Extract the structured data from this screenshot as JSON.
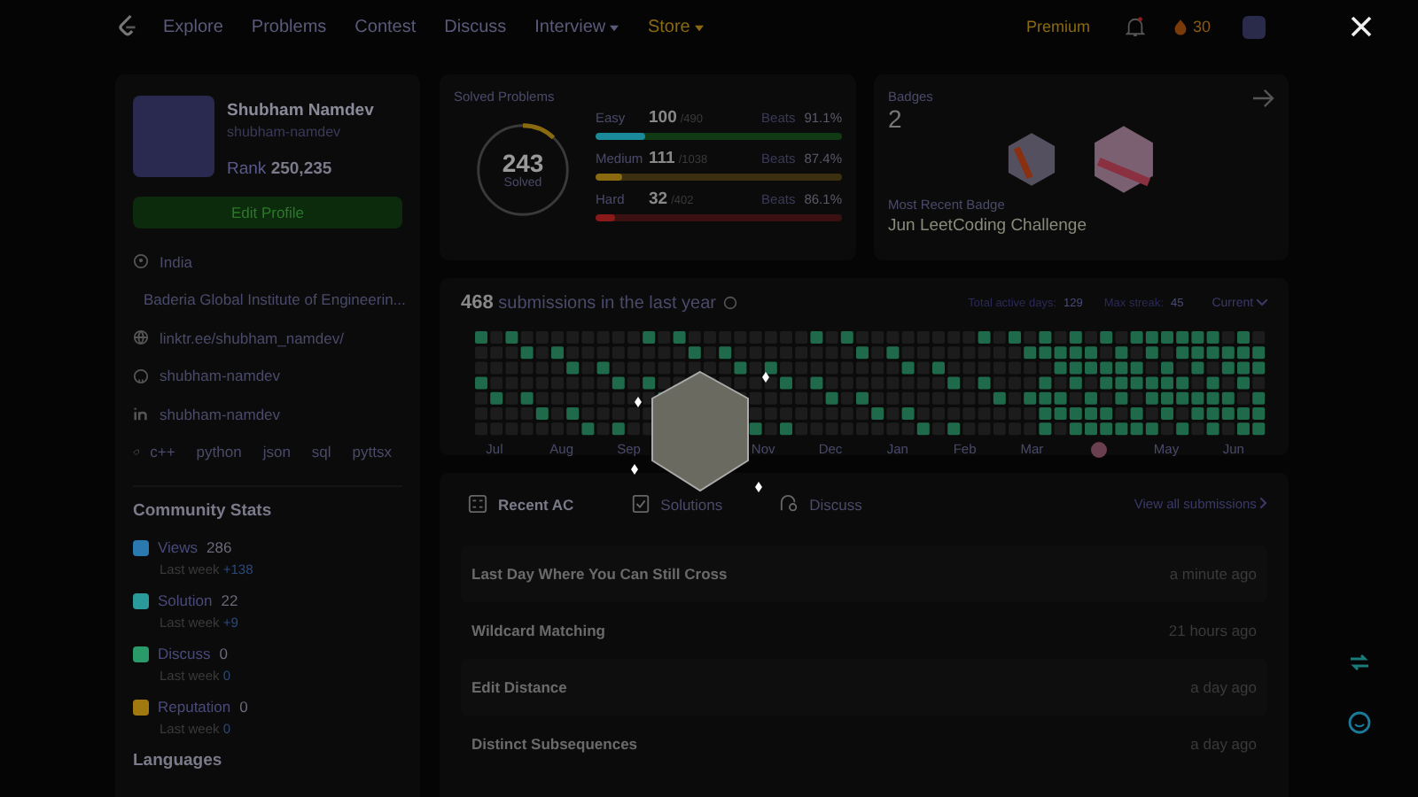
{
  "nav": {
    "items": [
      {
        "label": "Explore",
        "kind": "link"
      },
      {
        "label": "Problems",
        "kind": "link"
      },
      {
        "label": "Contest",
        "kind": "link"
      },
      {
        "label": "Discuss",
        "kind": "link"
      },
      {
        "label": "Interview",
        "kind": "menu"
      },
      {
        "label": "Store",
        "kind": "store"
      }
    ],
    "premium": "Premium",
    "coins": "30"
  },
  "profile": {
    "name": "Shubham Namdev",
    "username": "shubham-namdev",
    "rank_label": "Rank",
    "rank": "250,235",
    "edit_button": "Edit Profile",
    "details": [
      {
        "kind": "location",
        "text": "India"
      },
      {
        "kind": "school",
        "text": "Baderia Global Institute of Engineerin..."
      },
      {
        "kind": "website",
        "text": "linktr.ee/shubham_namdev/"
      },
      {
        "kind": "github",
        "text": "shubham-namdev"
      },
      {
        "kind": "linkedin",
        "text": "shubham-namdev"
      }
    ],
    "skills": [
      "c++",
      "python",
      "json",
      "sql",
      "pyttsx"
    ]
  },
  "community": {
    "title": "Community Stats",
    "stats": [
      {
        "kind": "views",
        "label": "Views",
        "value": "286",
        "last_week": "Last week",
        "delta": "+138"
      },
      {
        "kind": "solution",
        "label": "Solution",
        "value": "22",
        "last_week": "Last week",
        "delta": "+9"
      },
      {
        "kind": "discuss",
        "label": "Discuss",
        "value": "0",
        "last_week": "Last week",
        "delta": "0"
      },
      {
        "kind": "reputation",
        "label": "Reputation",
        "value": "0",
        "last_week": "Last week",
        "delta": "0"
      }
    ]
  },
  "languages_title": "Languages",
  "solved": {
    "title": "Solved Problems",
    "total": "243",
    "total_label": "Solved",
    "level": 0.12,
    "rows": [
      {
        "kind": "easy",
        "label": "Easy",
        "count": "100",
        "of": "/490",
        "beats_label": "Beats",
        "beats": "91.1%",
        "level": 0.2
      },
      {
        "kind": "medium",
        "label": "Medium",
        "count": "111",
        "of": "/1038",
        "beats_label": "Beats",
        "beats": "87.4%",
        "level": 0.11
      },
      {
        "kind": "hard",
        "label": "Hard",
        "count": "32",
        "of": "/402",
        "beats_label": "Beats",
        "beats": "86.1%",
        "level": 0.08
      }
    ]
  },
  "badges": {
    "title": "Badges",
    "count": "2",
    "recent_label": "Most Recent Badge",
    "recent": "Jun LeetCoding Challenge"
  },
  "calendar": {
    "count": "468",
    "text": "submissions in the last year",
    "active_label": "Total active days:",
    "active": "129",
    "streak_label": "Max streak:",
    "streak": "45",
    "range": "Current",
    "months": [
      {
        "label": "Jul",
        "kind": "text"
      },
      {
        "label": "Aug",
        "kind": "text"
      },
      {
        "label": "Sep",
        "kind": "text"
      },
      {
        "kind": "gap"
      },
      {
        "label": "Nov",
        "kind": "text"
      },
      {
        "label": "Dec",
        "kind": "text"
      },
      {
        "label": "Jan",
        "kind": "text"
      },
      {
        "label": "Feb",
        "kind": "text"
      },
      {
        "label": "Mar",
        "kind": "text"
      },
      {
        "kind": "badge"
      },
      {
        "label": "May",
        "kind": "text"
      },
      {
        "label": "Jun",
        "kind": "text"
      }
    ]
  },
  "recent": {
    "tabs": [
      {
        "label": "Recent AC",
        "kind": "ac",
        "selected": true
      },
      {
        "label": "Solutions",
        "kind": "solutions",
        "selected": false
      },
      {
        "label": "Discuss",
        "kind": "discuss",
        "selected": false
      }
    ],
    "view_all": "View all submissions",
    "rows": [
      {
        "title": "Last Day Where You Can Still Cross",
        "time": "a minute ago"
      },
      {
        "title": "Wildcard Matching",
        "time": "21 hours ago"
      },
      {
        "title": "Edit Distance",
        "time": "a day ago"
      },
      {
        "title": "Distinct Subsequences",
        "time": "a day ago"
      }
    ]
  }
}
